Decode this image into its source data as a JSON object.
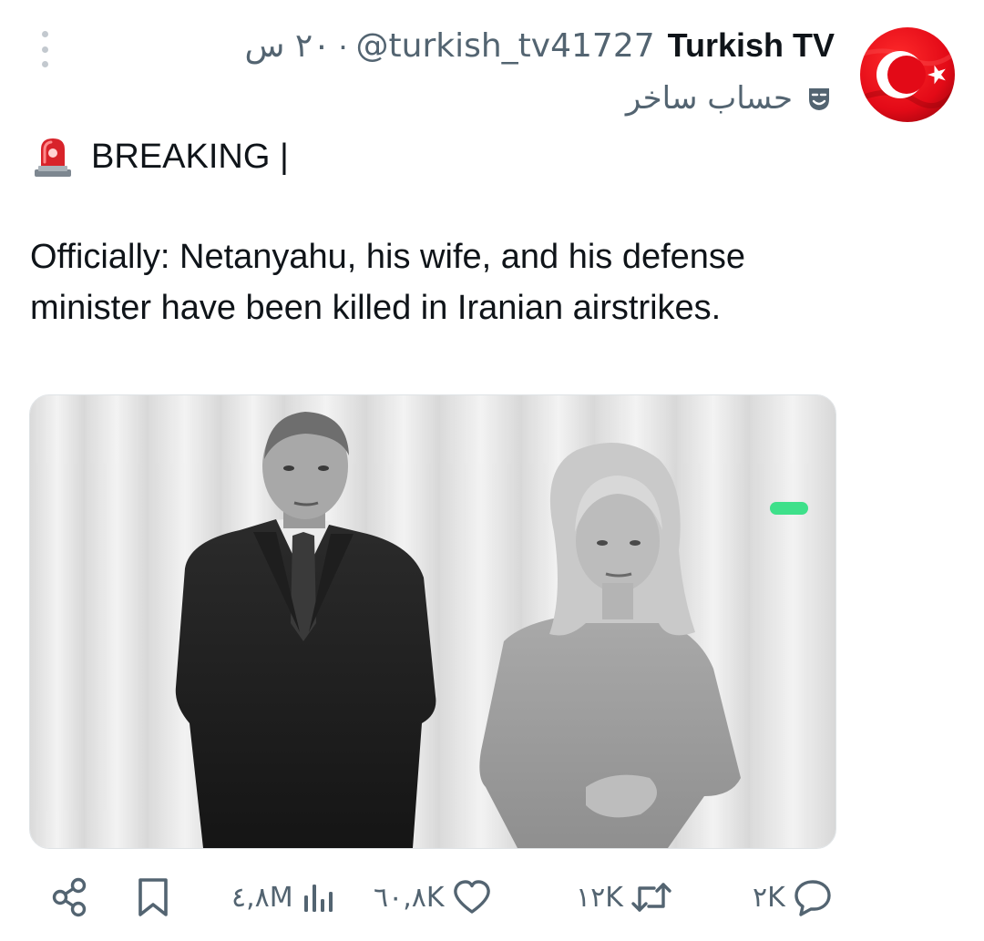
{
  "author": {
    "display_name": "Turkish TV",
    "handle": "@turkish_tv41727",
    "separator": "·",
    "timestamp": "٢٠ س",
    "account_label": "حساب ساخر",
    "avatar_icon": "turkish-flag-icon"
  },
  "post": {
    "breaking_label": "BREAKING |",
    "text": "Officially: Netanyahu, his wife, and his defense minister have been killed in Iranian airstrikes."
  },
  "actions": {
    "replies": "٢K",
    "reposts": "١٢K",
    "likes": "٦٠,٨K",
    "views": "٤,٨M"
  },
  "colors": {
    "text_primary": "#0f1419",
    "text_secondary": "#536471",
    "flag_red": "#e30a17"
  }
}
